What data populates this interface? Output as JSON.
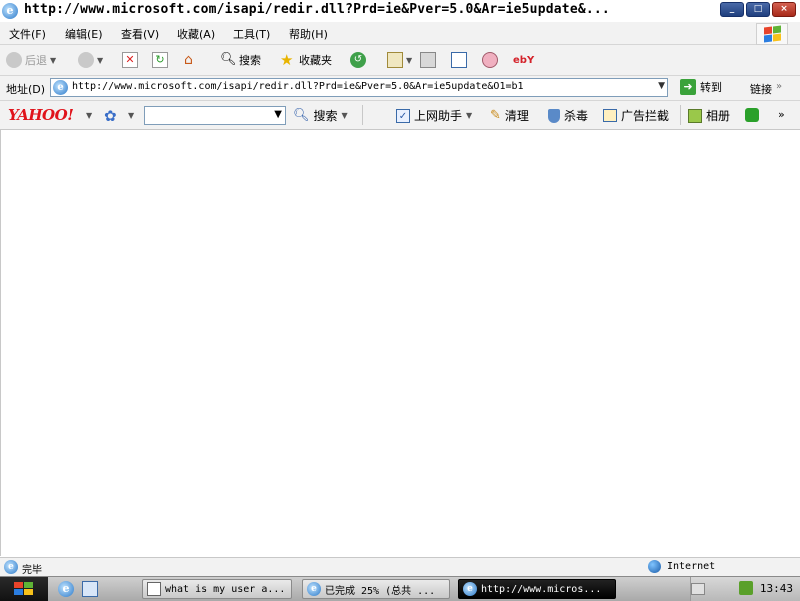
{
  "window": {
    "title": "http://www.microsoft.com/isapi/redir.dll?Prd=ie&Pver=5.0&Ar=ie5update&...",
    "controls": [
      "_",
      "□",
      "×"
    ]
  },
  "menu": {
    "items": [
      "文件(F)",
      "编辑(E)",
      "查看(V)",
      "收藏(A)",
      "工具(T)",
      "帮助(H)"
    ]
  },
  "toolbar": {
    "back_label": "后退",
    "search_label": "搜索",
    "favorites_label": "收藏夹",
    "ebay_label": "ebY"
  },
  "address": {
    "label": "地址(D)",
    "url": "http://www.microsoft.com/isapi/redir.dll?Prd=ie&Pver=5.0&Ar=ie5update&O1=b1",
    "go_label": "转到",
    "links_label": "链接",
    "more": "»"
  },
  "yahoo": {
    "logo": "YAHOO!",
    "search_value": "",
    "search_label": "搜索",
    "assistant_label": "上网助手",
    "clean_label": "清理",
    "antivirus_label": "杀毒",
    "popup_block_label": "广告拦截",
    "album_label": "相册",
    "more": "»"
  },
  "status": {
    "text": "完毕",
    "zone": "Internet"
  },
  "taskbar": {
    "tasks": [
      {
        "label": "what is my user a...",
        "active": false
      },
      {
        "label": "已完成 25% (总共 ...",
        "active": false
      },
      {
        "label": "http://www.micros...",
        "active": true
      }
    ],
    "clock": "13:43"
  },
  "colors": {
    "yahoo_red": "#e0131b",
    "accent_blue": "#2a78c8",
    "go_green": "#3aa23a"
  }
}
